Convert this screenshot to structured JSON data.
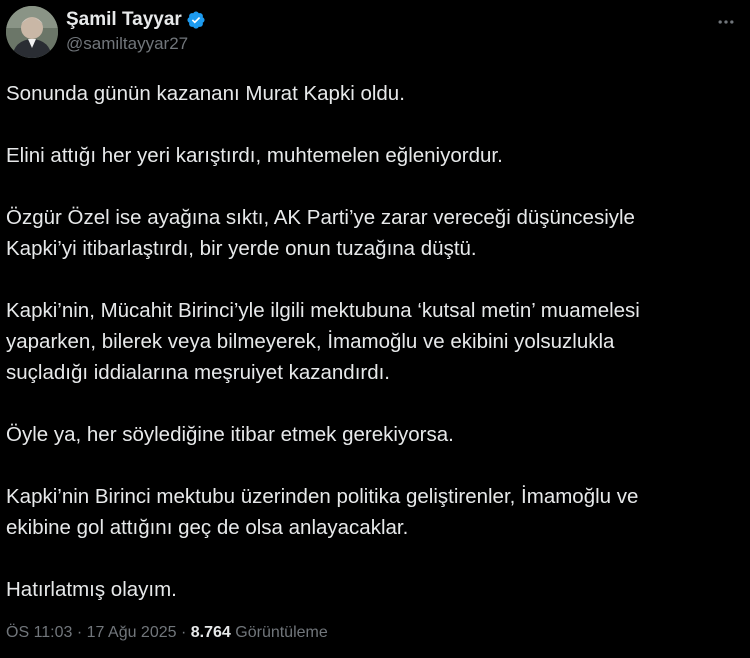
{
  "author": {
    "display_name": "Şamil Tayyar",
    "handle": "@samiltayyar27",
    "verified": true
  },
  "tweet": {
    "paragraphs": [
      "Sonunda günün kazananı Murat Kapki oldu.",
      "Elini attığı her yeri karıştırdı, muhtemelen eğleniyordur.",
      "Özgür Özel ise ayağına sıktı, AK Parti’ye zarar vereceği düşüncesiyle\nKapki’yi itibarlaştırdı, bir yerde onun tuzağına düştü.",
      "Kapki’nin, Mücahit Birinci’yle ilgili mektubuna ‘kutsal metin’ muamelesi\nyaparken, bilerek veya bilmeyerek, İmamoğlu ve ekibini yolsuzlukla\nsuçladığı iddialarına meşruiyet kazandırdı.",
      "Öyle ya, her söylediğine itibar etmek gerekiyorsa.",
      "Kapki’nin Birinci mektubu üzerinden politika geliştirenler, İmamoğlu ve\nekibine gol attığını geç de olsa anlayacaklar.",
      "Hatırlatmış olayım."
    ]
  },
  "meta": {
    "time": "ÖS 11:03",
    "separator": "·",
    "date": "17 Ağu 2025",
    "views_count": "8.764",
    "views_label": "Görüntüleme"
  },
  "icons": {
    "verified": "verified-badge-icon",
    "more": "more-options-icon"
  },
  "colors": {
    "background": "#000000",
    "text": "#e7e9ea",
    "secondary": "#71767b",
    "verified": "#1d9bf0"
  }
}
